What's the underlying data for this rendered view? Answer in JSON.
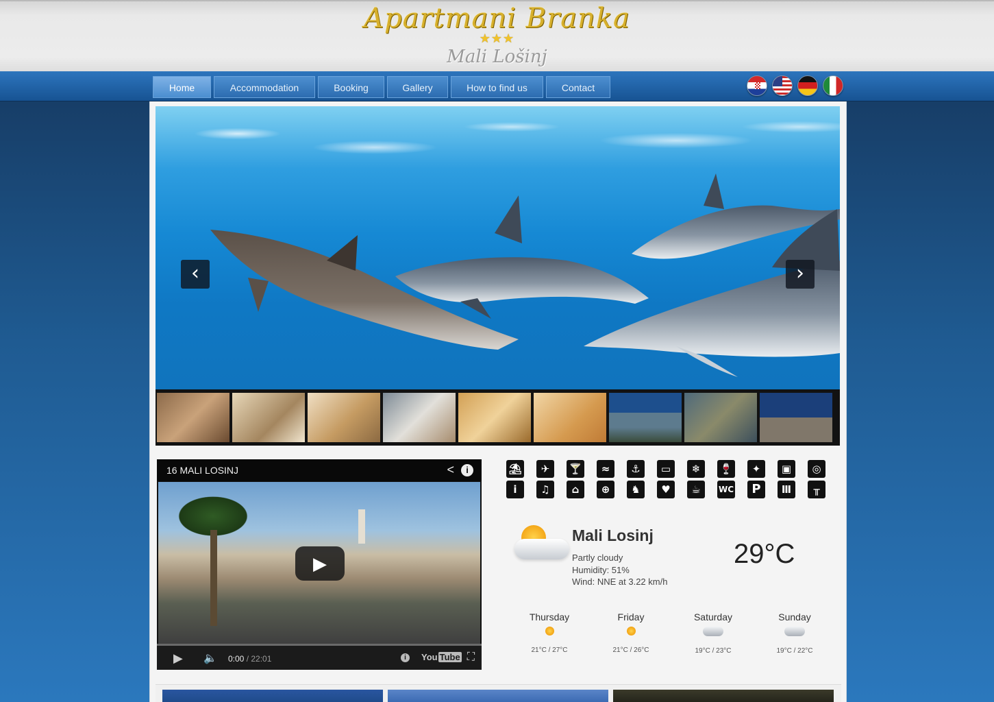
{
  "site": {
    "title": "Apartmani Branka",
    "stars": "★★★",
    "subtitle": "Mali Lošinj"
  },
  "nav": {
    "items": [
      {
        "label": "Home",
        "active": true
      },
      {
        "label": "Accommodation"
      },
      {
        "label": "Booking"
      },
      {
        "label": "Gallery"
      },
      {
        "label": "How to find us"
      },
      {
        "label": "Contact"
      }
    ]
  },
  "languages": [
    "croatian-flag-icon",
    "us-flag-icon",
    "german-flag-icon",
    "italian-flag-icon"
  ],
  "slider": {
    "prev_glyph": "‹",
    "next_glyph": "›",
    "thumbnail_count": 9
  },
  "video": {
    "title": "16 MALI LOSINJ",
    "current_time": "0:00",
    "total_time": "/ 22:01",
    "brand_you": "You",
    "brand_tube": "Tube"
  },
  "amenities": {
    "row1": [
      "beach-icon",
      "airport-icon",
      "bar-icon",
      "swimming-icon",
      "diving-icon",
      "tv-icon",
      "air-conditioning-icon",
      "wine-icon",
      "satellite-icon",
      "safe-icon",
      "laundry-icon"
    ],
    "row2": [
      "info-icon",
      "music-icon",
      "house-icon",
      "stroller-icon",
      "pets-icon",
      "washing-icon",
      "kettle-icon",
      "wc-icon",
      "parking-icon",
      "radiator-icon",
      "picnic-icon"
    ],
    "row2_text": {
      "info": "i",
      "wc": "WC",
      "parking": "P"
    }
  },
  "weather": {
    "city": "Mali Losinj",
    "condition": "Partly cloudy",
    "humidity": "Humidity: 51%",
    "wind": "Wind: NNE at 3.22 km/h",
    "temperature": "29°C",
    "forecast": [
      {
        "day": "Thursday",
        "icon": "sunny",
        "temps": "21°C / 27°C"
      },
      {
        "day": "Friday",
        "icon": "sunny",
        "temps": "21°C / 26°C"
      },
      {
        "day": "Saturday",
        "icon": "cloudy",
        "temps": "19°C / 23°C"
      },
      {
        "day": "Sunday",
        "icon": "cloudy",
        "temps": "19°C / 22°C"
      }
    ]
  },
  "colors": {
    "accent": "#2c6cb0",
    "logo_gold": "#d7b02c",
    "page_bg": "#1f5b92"
  }
}
